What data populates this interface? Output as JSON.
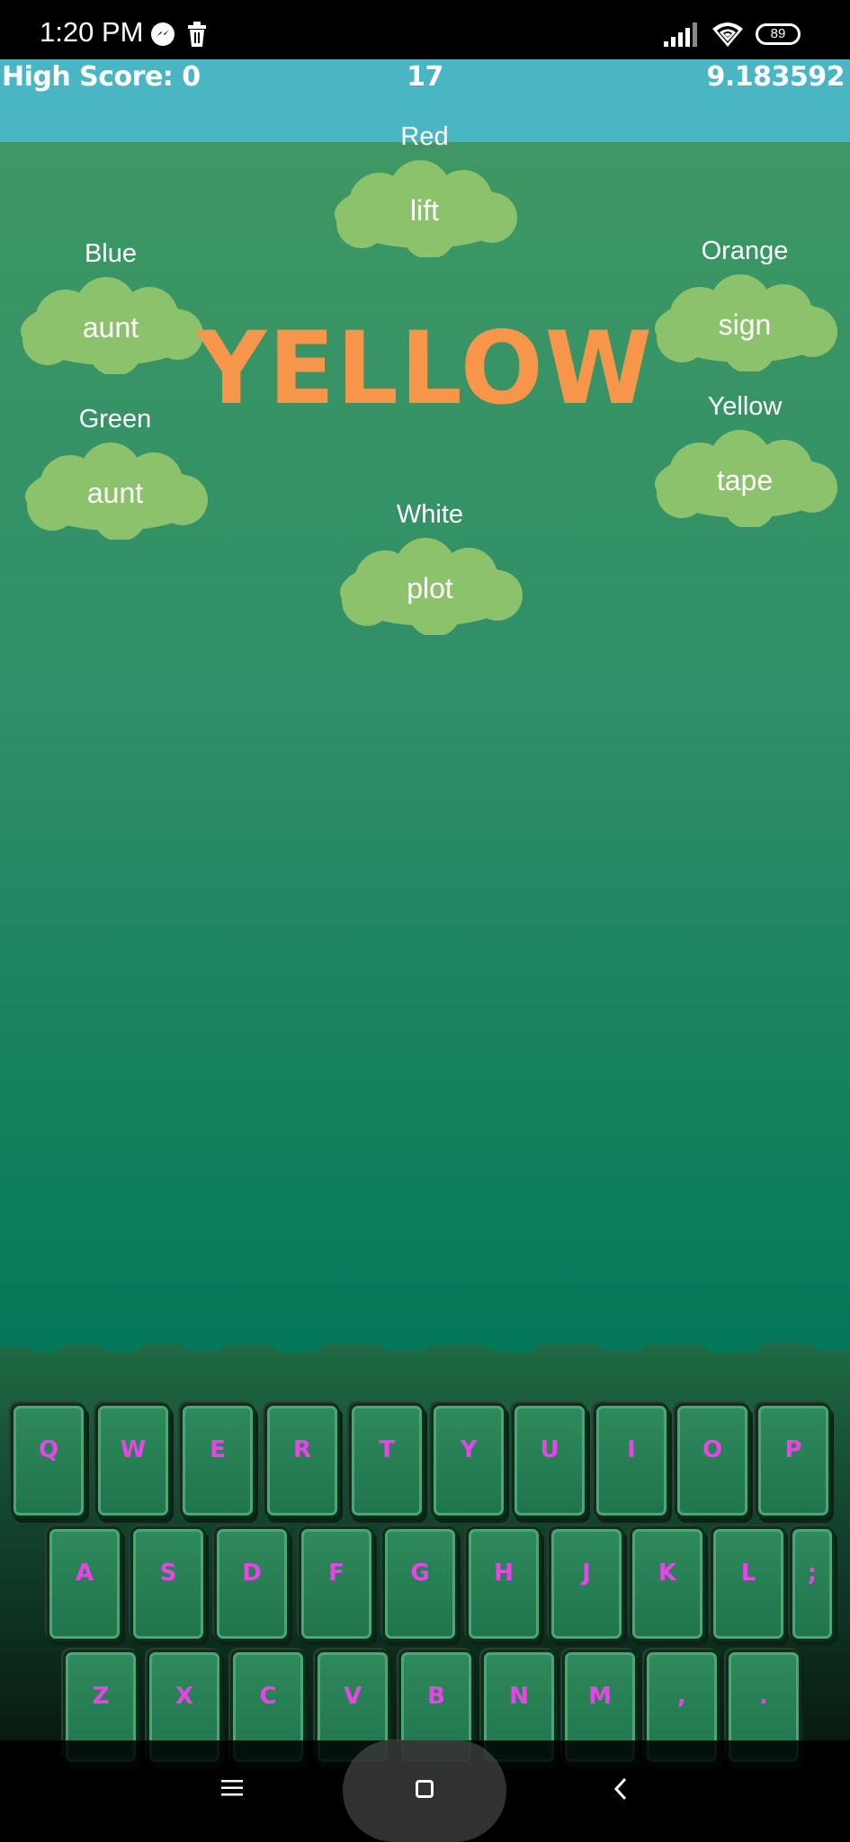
{
  "status_bar": {
    "time": "1:20 PM",
    "battery": "89",
    "icons": [
      "messenger-icon",
      "trash-icon",
      "signal-icon",
      "wifi-icon",
      "battery-icon"
    ]
  },
  "hud": {
    "high_score": "High Score: 0",
    "score": "17",
    "timer": "9.183592",
    "bg_color": "#4ab6c3"
  },
  "target_color_word": "YELLOW",
  "target_color_hex": "#f7954a",
  "clouds": [
    {
      "color": "Red",
      "word": "lift"
    },
    {
      "color": "Blue",
      "word": "aunt"
    },
    {
      "color": "Orange",
      "word": "sign"
    },
    {
      "color": "Green",
      "word": "aunt"
    },
    {
      "color": "Yellow",
      "word": "tape"
    },
    {
      "color": "White",
      "word": "plot"
    }
  ],
  "keyboard": {
    "row1": [
      "Q",
      "W",
      "E",
      "R",
      "T",
      "Y",
      "U",
      "I",
      "O",
      "P"
    ],
    "row2": [
      "A",
      "S",
      "D",
      "F",
      "G",
      "H",
      "J",
      "K",
      "L",
      ";"
    ],
    "row3": [
      "Z",
      "X",
      "C",
      "V",
      "B",
      "N",
      "M",
      ",",
      "."
    ],
    "key_text_color": "#e844e8"
  },
  "nav_bar": {
    "icons": [
      "menu-icon",
      "home-icon",
      "back-icon"
    ]
  }
}
